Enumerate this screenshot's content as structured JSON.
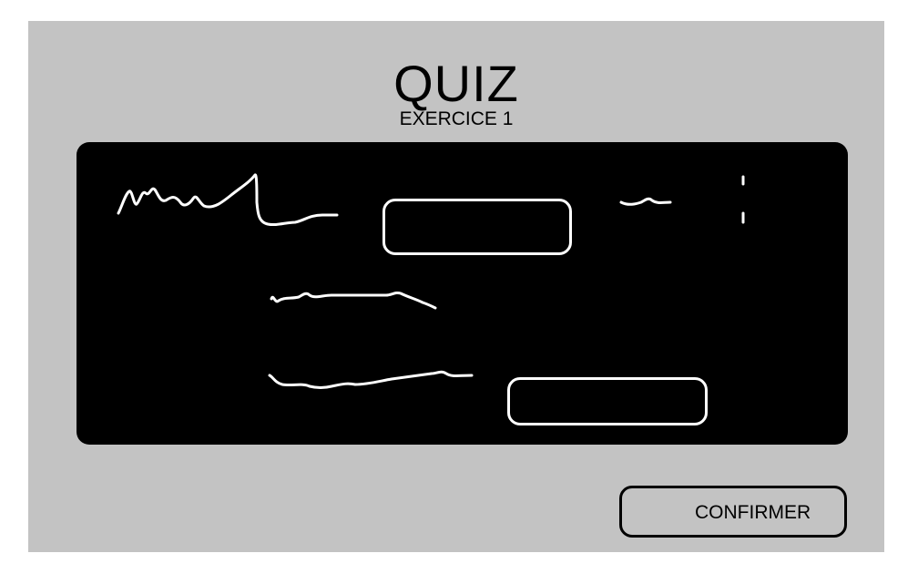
{
  "window": {
    "title": "QUIZ",
    "subtitle": "EXERCICE 1"
  },
  "quiz_board": {
    "answer_fields": [
      {
        "value": "",
        "placeholder": ""
      },
      {
        "value": "",
        "placeholder": ""
      }
    ]
  },
  "actions": {
    "confirm_label": "CONFIRMER"
  },
  "colors": {
    "background": "#c3c3c3",
    "board": "#000000",
    "stroke_on_board": "#ffffff"
  }
}
